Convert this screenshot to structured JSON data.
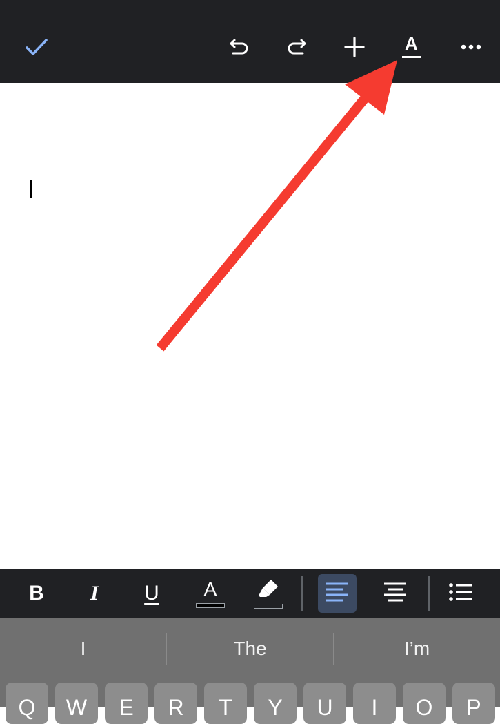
{
  "colors": {
    "toolbar_bg": "#202124",
    "accent_blue": "#8ab4f8",
    "arrow_red": "#f53b30",
    "keyboard_bg": "#707070",
    "key_bg": "#8d8d8d"
  },
  "top_toolbar": {
    "icons": [
      "check-icon",
      "undo-icon",
      "redo-icon",
      "plus-icon",
      "text-format-icon",
      "more-icon"
    ],
    "format_label": "A"
  },
  "format_toolbar": {
    "bold_label": "B",
    "italic_label": "I",
    "underline_label": "U",
    "text_color_label": "A",
    "icons": [
      "highlighter-icon",
      "align-left-icon",
      "align-center-icon",
      "bulleted-list-icon"
    ],
    "selected_alignment": "left"
  },
  "keyboard": {
    "suggestions": [
      "I",
      "The",
      "I’m"
    ],
    "keys": [
      "Q",
      "W",
      "E",
      "R",
      "T",
      "Y",
      "U",
      "I",
      "O",
      "P"
    ]
  }
}
